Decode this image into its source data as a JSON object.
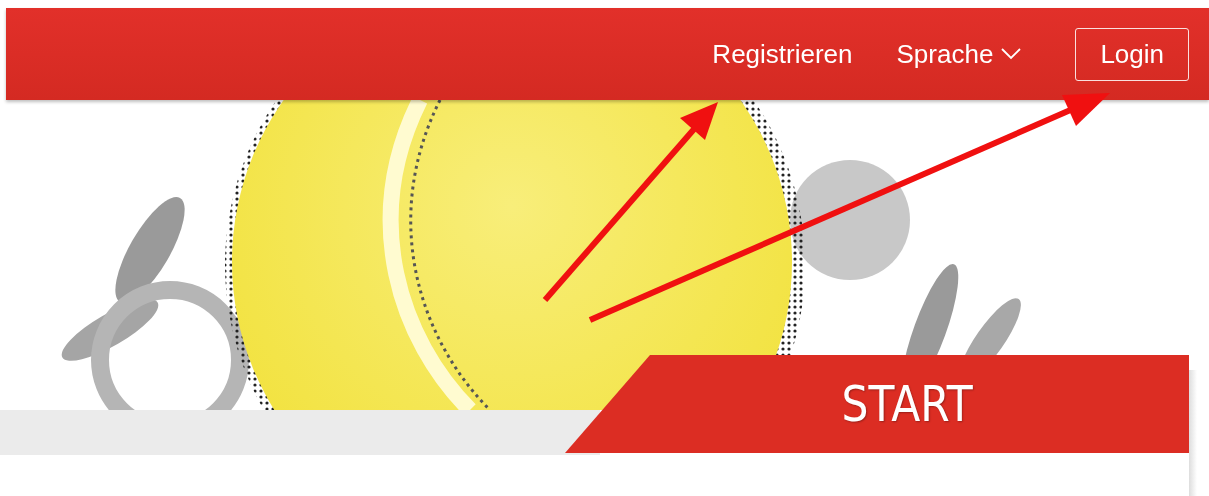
{
  "nav": {
    "items": [
      {
        "label": "Registrieren",
        "kind": "link"
      },
      {
        "label": "Sprache",
        "kind": "dropdown"
      },
      {
        "label": "Login",
        "kind": "button"
      }
    ]
  },
  "banner": {
    "title": "START"
  }
}
